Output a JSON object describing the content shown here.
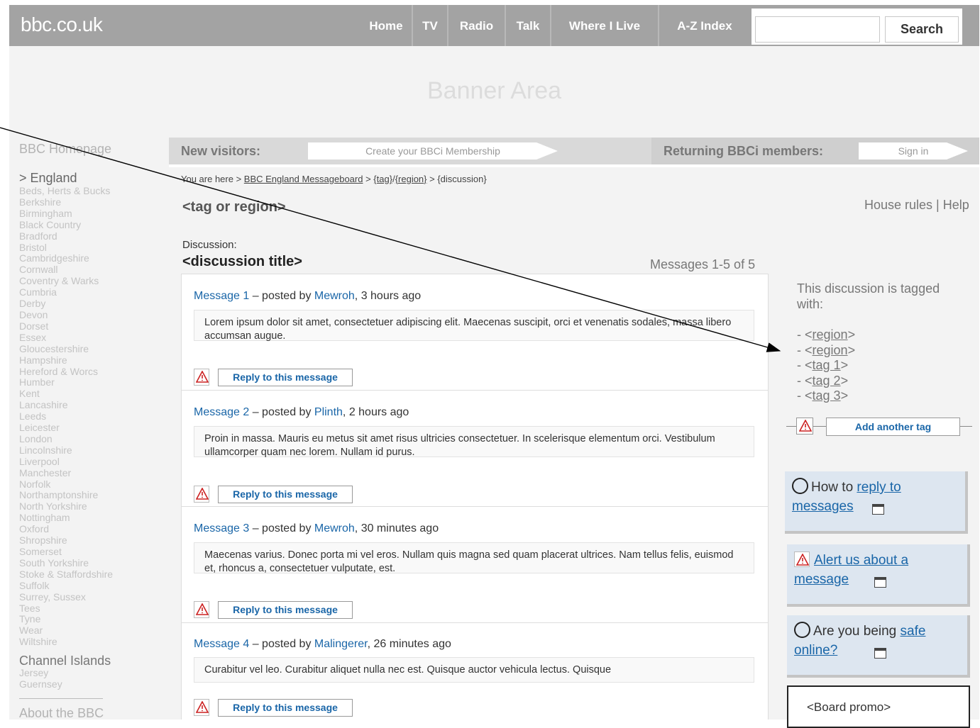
{
  "header": {
    "logo": "bbc.co.uk",
    "nav": [
      {
        "label": "Home"
      },
      {
        "label": "TV"
      },
      {
        "label": "Radio"
      },
      {
        "label": "Talk"
      },
      {
        "label": "Where I Live"
      },
      {
        "label": "A-Z Index"
      }
    ],
    "search": {
      "placeholder": "",
      "button_label": "Search"
    }
  },
  "banner": {
    "text": "Banner Area"
  },
  "sidebar": {
    "home_link": "BBC Homepage",
    "region": "> England",
    "counties": [
      "Beds, Herts & Bucks",
      "Berkshire",
      "Birmingham",
      "Black Country",
      "Bradford",
      "Bristol",
      "Cambridgeshire",
      "Cornwall",
      "Coventry & Warks",
      "Cumbria",
      "Derby",
      "Devon",
      "Dorset",
      "Essex",
      "Gloucestershire",
      "Hampshire",
      "Hereford & Worcs",
      "Humber",
      "Kent",
      "Lancashire",
      "Leeds",
      "Leicester",
      "London",
      "Lincolnshire",
      "Liverpool",
      "Manchester",
      "Norfolk",
      "Northamptonshire",
      "North Yorkshire",
      "Nottingham",
      "Oxford",
      "Shropshire",
      "Somerset",
      "South Yorkshire",
      "Stoke & Staffordshire",
      "Suffolk",
      "Surrey, Sussex",
      "Tees",
      "Tyne",
      "Wear",
      "Wiltshire"
    ],
    "channel_islands": "Channel Islands",
    "jersey": "Jersey",
    "guernsey": "Guernsey",
    "about": "About the BBC"
  },
  "membership": {
    "new_label": "New visitors:",
    "new_button": "Create your BBCi Membership",
    "returning_label": "Returning BBCi members:",
    "returning_button": "Sign in"
  },
  "breadcrumb": {
    "prefix": "You are here > ",
    "board": "BBC England Messageboard",
    "sep1": " > ",
    "tag": "{tag}",
    "slash": "/",
    "region": "{region}",
    "tail": " > {discussion}"
  },
  "page": {
    "tag_title": "<tag or region>",
    "house_rules": "House rules | Help",
    "discussion_label": "Discussion:",
    "discussion_title": "<discussion title>",
    "message_count": "Messages 1-5 of 5"
  },
  "messages": [
    {
      "num": "Message 1",
      "posted_by": " – posted by ",
      "author": "Mewroh",
      "time": ", 3 hours ago",
      "body": "Lorem ipsum dolor sit amet, consectetuer adipiscing elit. Maecenas suscipit, orci et venenatis sodales, massa libero accumsan augue.",
      "reply": "Reply to this message"
    },
    {
      "num": "Message 2",
      "posted_by": " – posted by ",
      "author": "Plinth",
      "time": ", 2 hours ago",
      "body": "Proin in massa. Mauris eu metus sit amet risus ultricies consectetuer. In scelerisque elementum orci. Vestibulum ullamcorper quam nec lorem. Nullam id purus.",
      "reply": "Reply to this message"
    },
    {
      "num": "Message 3",
      "posted_by": " – posted by ",
      "author": "Mewroh",
      "time": ", 30 minutes ago",
      "body": "Maecenas varius. Donec porta mi vel eros. Nullam quis magna sed quam placerat ultrices. Nam tellus felis, euismod et, rhoncus a, consectetuer vulputate, est.",
      "reply": "Reply to this message"
    },
    {
      "num": "Message 4",
      "posted_by": " – posted by ",
      "author": "Malingerer",
      "time": ", 26 minutes ago",
      "body": "Curabitur vel leo. Curabitur aliquet nulla nec est. Quisque auctor vehicula lectus. Quisque",
      "reply": "Reply to this message"
    }
  ],
  "tags": {
    "intro": "This discussion is tagged with:",
    "items": [
      {
        "prefix": "- <",
        "label": "region",
        "suffix": ">"
      },
      {
        "prefix": "- <",
        "label": "region",
        "suffix": ">"
      },
      {
        "prefix": "- <",
        "label": "tag 1",
        "suffix": ">"
      },
      {
        "prefix": "- <",
        "label": "tag 2",
        "suffix": ">"
      },
      {
        "prefix": "- <",
        "label": "tag 3",
        "suffix": ">"
      }
    ],
    "add_button": "Add another tag"
  },
  "help": {
    "reply_prefix": "How to ",
    "reply_link_1": "reply to",
    "reply_link_2": "messages",
    "alert_link_1": "Alert us about a",
    "alert_link_2": "message",
    "safe_prefix": "Are you being ",
    "safe_link_1": "safe",
    "safe_link_2": "online?"
  },
  "promo": {
    "text": "<Board promo>"
  },
  "icons": {
    "alert": "warning-triangle-icon",
    "circle": "circle-icon",
    "window": "popup-window-icon",
    "alert_color": "#cc2222",
    "link_color": "#1a66a8"
  }
}
